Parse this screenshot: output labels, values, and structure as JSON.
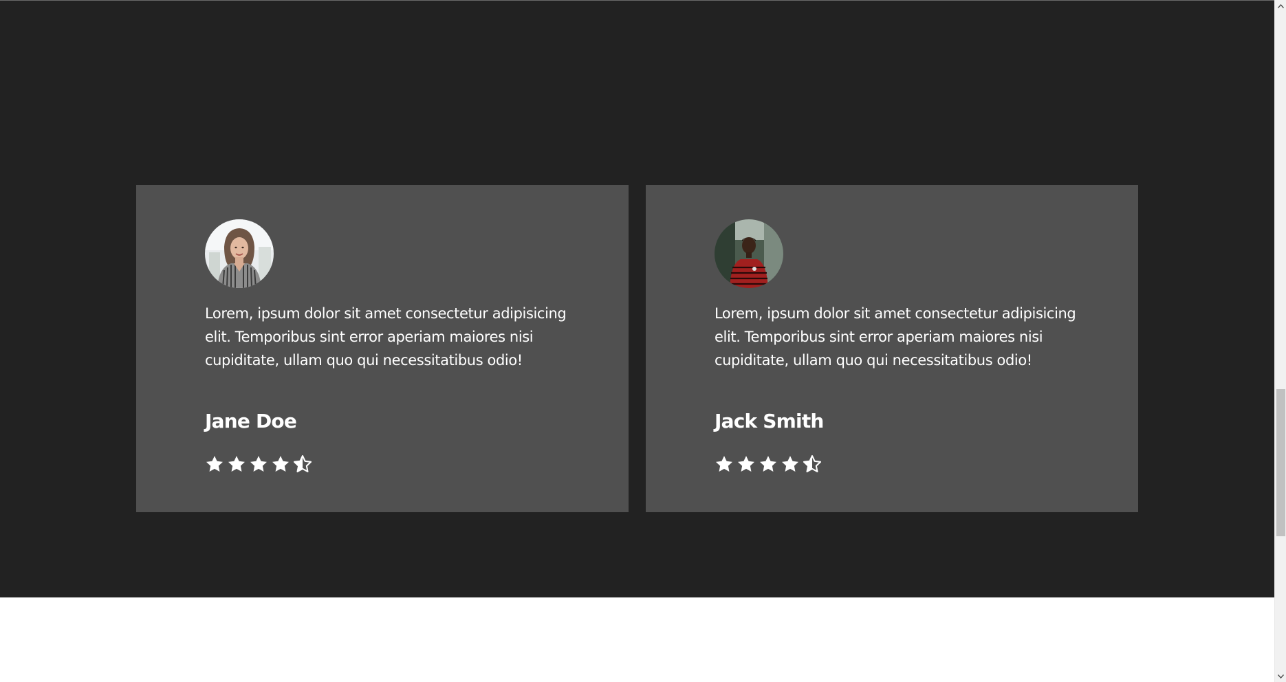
{
  "testimonials": [
    {
      "avatar_icon": "woman-portrait-avatar",
      "quote": "Lorem, ipsum dolor sit amet consectetur adipisicing elit. Temporibus sint error aperiam maiores nisi cupiditate, ullam quo qui necessitatibus odio!",
      "name": "Jane Doe",
      "rating": 4.5,
      "stars": [
        "star-full",
        "star-full",
        "star-full",
        "star-full",
        "star-half"
      ]
    },
    {
      "avatar_icon": "man-portrait-avatar",
      "quote": "Lorem, ipsum dolor sit amet consectetur adipisicing elit. Temporibus sint error aperiam maiores nisi cupiditate, ullam quo qui necessitatibus odio!",
      "name": "Jack Smith",
      "rating": 4.5,
      "stars": [
        "star-full",
        "star-full",
        "star-full",
        "star-full",
        "star-half"
      ]
    }
  ],
  "colors": {
    "section_background": "#222222",
    "card_background": "#505050",
    "text": "#ffffff",
    "page_background": "#ffffff",
    "scrollbar_track": "#f1f1f1",
    "scrollbar_thumb": "#c1c1c1"
  },
  "scrollbar": {
    "up_icon": "chevron-up-icon",
    "down_icon": "chevron-down-icon"
  }
}
